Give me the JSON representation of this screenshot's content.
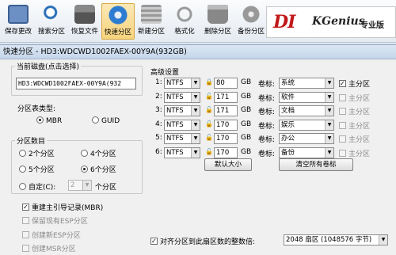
{
  "toolbar": {
    "buttons": [
      {
        "label": "保存更改",
        "icon": "save-icon"
      },
      {
        "label": "搜索分区",
        "icon": "search-icon"
      },
      {
        "label": "恢复文件",
        "icon": "restore-icon"
      },
      {
        "label": "快速分区",
        "icon": "quick-partition-icon"
      },
      {
        "label": "新建分区",
        "icon": "new-partition-icon"
      },
      {
        "label": "格式化",
        "icon": "format-icon"
      },
      {
        "label": "删除分区",
        "icon": "delete-icon"
      },
      {
        "label": "备份分区",
        "icon": "backup-icon"
      }
    ],
    "logo": {
      "main": "DI",
      "sub": "KGenius",
      "cn": "专业版"
    }
  },
  "dialog": {
    "title": "快速分区 - HD3:WDCWD1002FAEX-00Y9A(932GB)",
    "disk_group_title": "当前磁盘(点击选择)",
    "disk_value": "HD3:WDCWD1002FAEX-00Y9A(932",
    "ptype_label": "分区表类型:",
    "ptype_options": {
      "mbr": "MBR",
      "guid": "GUID"
    },
    "count_group_title": "分区数目",
    "count_options": {
      "c2": "2个分区",
      "c4": "4个分区",
      "c5": "5个分区",
      "c6": "6个分区",
      "custom": "自定(C):"
    },
    "custom_value": "2",
    "custom_unit": "个分区",
    "mbr_rebuild": "重建主引导记录(MBR)",
    "keep_esp": "保留现有ESP分区",
    "create_esp": "创建新ESP分区",
    "create_msr": "创建MSR分区",
    "advanced_title": "高级设置",
    "unit": "GB",
    "label_prefix": "卷标:",
    "primary_label": "主分区",
    "partitions": [
      {
        "idx": "1:",
        "fs": "NTFS",
        "size": "80",
        "label": "系统",
        "primary": true
      },
      {
        "idx": "2:",
        "fs": "NTFS",
        "size": "171",
        "label": "软件",
        "primary": false
      },
      {
        "idx": "3:",
        "fs": "NTFS",
        "size": "171",
        "label": "文档",
        "primary": false
      },
      {
        "idx": "4:",
        "fs": "NTFS",
        "size": "170",
        "label": "娱乐",
        "primary": false
      },
      {
        "idx": "5:",
        "fs": "NTFS",
        "size": "170",
        "label": "办公",
        "primary": false
      },
      {
        "idx": "6:",
        "fs": "NTFS",
        "size": "170",
        "label": "备份",
        "primary": false
      }
    ],
    "default_size_button": "默认大小",
    "clear_labels_button": "清空所有卷标",
    "align_label": "对齐分区到此扇区数的整数倍:",
    "align_value": "2048 扇区 (1048576 字节)"
  },
  "colors": {
    "accent": "#c01818",
    "active_tool": "#f7d37c"
  }
}
